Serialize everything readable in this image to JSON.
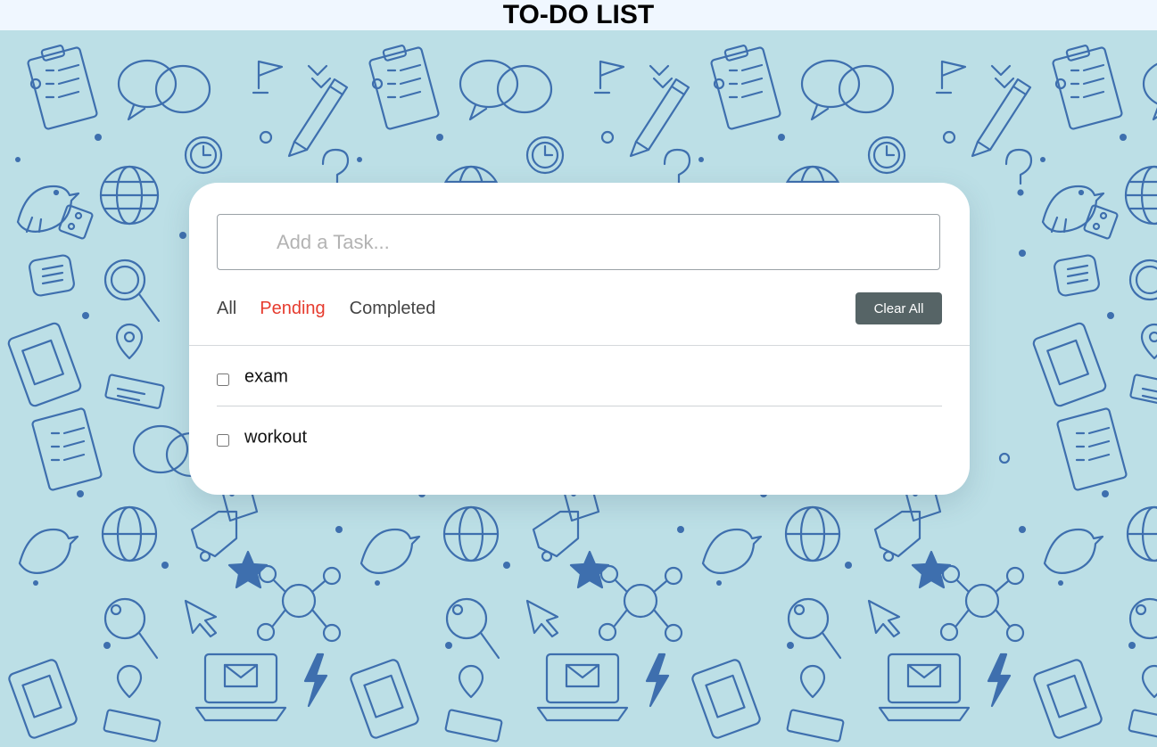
{
  "header": {
    "title": "TO-DO LIST"
  },
  "colors": {
    "background": "#bcdfe6",
    "pattern": "#3e6fae",
    "header_bg": "#f0f7ff",
    "active_filter": "#e63b2e",
    "clear_button": "#566466"
  },
  "input": {
    "placeholder": "Add a Task...",
    "value": ""
  },
  "filters": [
    {
      "label": "All",
      "active": false
    },
    {
      "label": "Pending",
      "active": true
    },
    {
      "label": "Completed",
      "active": false
    }
  ],
  "clear_button_label": "Clear All",
  "tasks": [
    {
      "name": "exam",
      "checked": false
    },
    {
      "name": "workout",
      "checked": false
    }
  ],
  "background_icons": [
    "clipboard-icon",
    "speech-bubble-icon",
    "pencil-icon",
    "flag-icon",
    "clock-icon",
    "globe-icon",
    "bird-icon",
    "question-mark-icon",
    "magnifier-icon",
    "laptop-mail-icon",
    "map-pin-icon",
    "network-icon",
    "star-icon",
    "lightning-icon",
    "thumbs-up-icon",
    "cursor-icon",
    "tag-icon",
    "tablet-icon"
  ]
}
